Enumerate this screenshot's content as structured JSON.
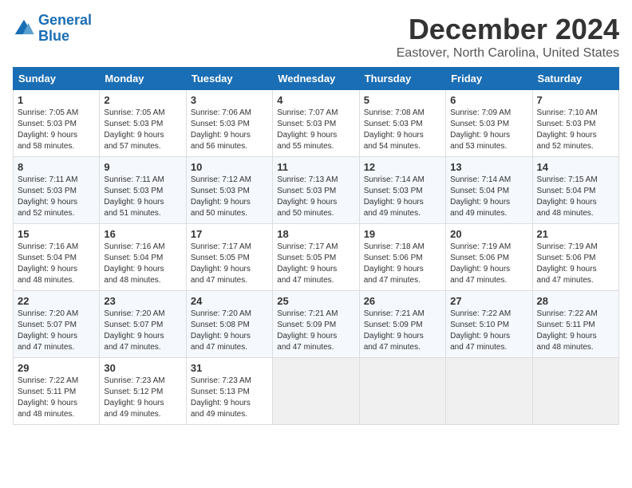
{
  "logo": {
    "line1": "General",
    "line2": "Blue"
  },
  "title": "December 2024",
  "subtitle": "Eastover, North Carolina, United States",
  "days_of_week": [
    "Sunday",
    "Monday",
    "Tuesday",
    "Wednesday",
    "Thursday",
    "Friday",
    "Saturday"
  ],
  "weeks": [
    [
      {
        "day": "1",
        "detail": "Sunrise: 7:05 AM\nSunset: 5:03 PM\nDaylight: 9 hours\nand 58 minutes."
      },
      {
        "day": "2",
        "detail": "Sunrise: 7:05 AM\nSunset: 5:03 PM\nDaylight: 9 hours\nand 57 minutes."
      },
      {
        "day": "3",
        "detail": "Sunrise: 7:06 AM\nSunset: 5:03 PM\nDaylight: 9 hours\nand 56 minutes."
      },
      {
        "day": "4",
        "detail": "Sunrise: 7:07 AM\nSunset: 5:03 PM\nDaylight: 9 hours\nand 55 minutes."
      },
      {
        "day": "5",
        "detail": "Sunrise: 7:08 AM\nSunset: 5:03 PM\nDaylight: 9 hours\nand 54 minutes."
      },
      {
        "day": "6",
        "detail": "Sunrise: 7:09 AM\nSunset: 5:03 PM\nDaylight: 9 hours\nand 53 minutes."
      },
      {
        "day": "7",
        "detail": "Sunrise: 7:10 AM\nSunset: 5:03 PM\nDaylight: 9 hours\nand 52 minutes."
      }
    ],
    [
      {
        "day": "8",
        "detail": "Sunrise: 7:11 AM\nSunset: 5:03 PM\nDaylight: 9 hours\nand 52 minutes."
      },
      {
        "day": "9",
        "detail": "Sunrise: 7:11 AM\nSunset: 5:03 PM\nDaylight: 9 hours\nand 51 minutes."
      },
      {
        "day": "10",
        "detail": "Sunrise: 7:12 AM\nSunset: 5:03 PM\nDaylight: 9 hours\nand 50 minutes."
      },
      {
        "day": "11",
        "detail": "Sunrise: 7:13 AM\nSunset: 5:03 PM\nDaylight: 9 hours\nand 50 minutes."
      },
      {
        "day": "12",
        "detail": "Sunrise: 7:14 AM\nSunset: 5:03 PM\nDaylight: 9 hours\nand 49 minutes."
      },
      {
        "day": "13",
        "detail": "Sunrise: 7:14 AM\nSunset: 5:04 PM\nDaylight: 9 hours\nand 49 minutes."
      },
      {
        "day": "14",
        "detail": "Sunrise: 7:15 AM\nSunset: 5:04 PM\nDaylight: 9 hours\nand 48 minutes."
      }
    ],
    [
      {
        "day": "15",
        "detail": "Sunrise: 7:16 AM\nSunset: 5:04 PM\nDaylight: 9 hours\nand 48 minutes."
      },
      {
        "day": "16",
        "detail": "Sunrise: 7:16 AM\nSunset: 5:04 PM\nDaylight: 9 hours\nand 48 minutes."
      },
      {
        "day": "17",
        "detail": "Sunrise: 7:17 AM\nSunset: 5:05 PM\nDaylight: 9 hours\nand 47 minutes."
      },
      {
        "day": "18",
        "detail": "Sunrise: 7:17 AM\nSunset: 5:05 PM\nDaylight: 9 hours\nand 47 minutes."
      },
      {
        "day": "19",
        "detail": "Sunrise: 7:18 AM\nSunset: 5:06 PM\nDaylight: 9 hours\nand 47 minutes."
      },
      {
        "day": "20",
        "detail": "Sunrise: 7:19 AM\nSunset: 5:06 PM\nDaylight: 9 hours\nand 47 minutes."
      },
      {
        "day": "21",
        "detail": "Sunrise: 7:19 AM\nSunset: 5:06 PM\nDaylight: 9 hours\nand 47 minutes."
      }
    ],
    [
      {
        "day": "22",
        "detail": "Sunrise: 7:20 AM\nSunset: 5:07 PM\nDaylight: 9 hours\nand 47 minutes."
      },
      {
        "day": "23",
        "detail": "Sunrise: 7:20 AM\nSunset: 5:07 PM\nDaylight: 9 hours\nand 47 minutes."
      },
      {
        "day": "24",
        "detail": "Sunrise: 7:20 AM\nSunset: 5:08 PM\nDaylight: 9 hours\nand 47 minutes."
      },
      {
        "day": "25",
        "detail": "Sunrise: 7:21 AM\nSunset: 5:09 PM\nDaylight: 9 hours\nand 47 minutes."
      },
      {
        "day": "26",
        "detail": "Sunrise: 7:21 AM\nSunset: 5:09 PM\nDaylight: 9 hours\nand 47 minutes."
      },
      {
        "day": "27",
        "detail": "Sunrise: 7:22 AM\nSunset: 5:10 PM\nDaylight: 9 hours\nand 47 minutes."
      },
      {
        "day": "28",
        "detail": "Sunrise: 7:22 AM\nSunset: 5:11 PM\nDaylight: 9 hours\nand 48 minutes."
      }
    ],
    [
      {
        "day": "29",
        "detail": "Sunrise: 7:22 AM\nSunset: 5:11 PM\nDaylight: 9 hours\nand 48 minutes."
      },
      {
        "day": "30",
        "detail": "Sunrise: 7:23 AM\nSunset: 5:12 PM\nDaylight: 9 hours\nand 49 minutes."
      },
      {
        "day": "31",
        "detail": "Sunrise: 7:23 AM\nSunset: 5:13 PM\nDaylight: 9 hours\nand 49 minutes."
      },
      null,
      null,
      null,
      null
    ]
  ]
}
